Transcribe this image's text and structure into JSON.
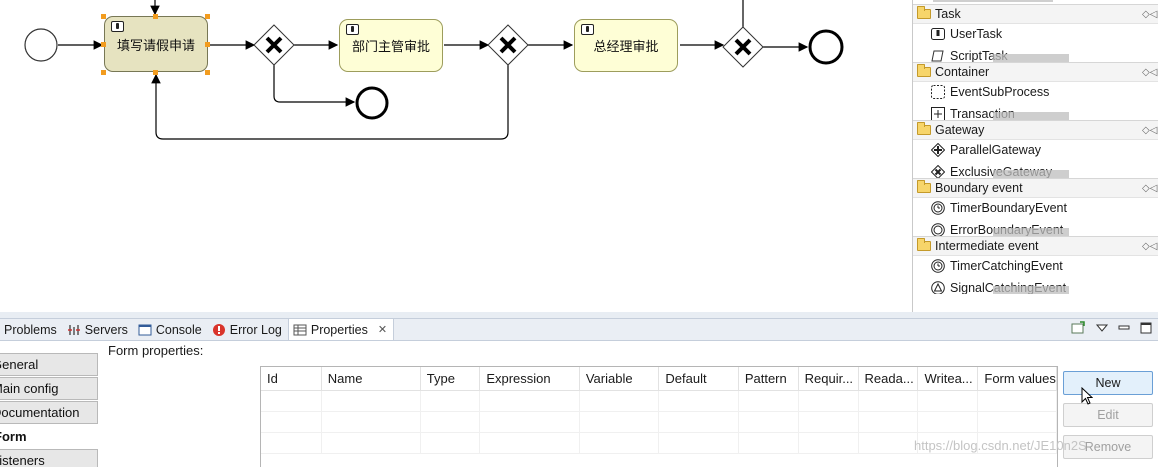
{
  "diagram": {
    "tasks": [
      {
        "id": "task-fill",
        "label": "填写请假申请",
        "selected": true
      },
      {
        "id": "task-dept",
        "label": "部门主管审批",
        "selected": false
      },
      {
        "id": "task-gm",
        "label": "总经理审批",
        "selected": false
      }
    ]
  },
  "palette": {
    "drawers": [
      {
        "title": "Task",
        "item": "UserTask",
        "item_icon": "user-task-icon",
        "cut_item": "ScriptTask"
      },
      {
        "title": "Container",
        "item": "EventSubProcess",
        "item_icon": "event-subprocess-icon",
        "cut_item": "Transaction"
      },
      {
        "title": "Gateway",
        "item": "ParallelGateway",
        "item_icon": "parallel-gateway-icon",
        "cut_item": "ExclusiveGateway"
      },
      {
        "title": "Boundary event",
        "item": "TimerBoundaryEvent",
        "item_icon": "timer-icon",
        "cut_item": "ErrorBoundaryEvent"
      },
      {
        "title": "Intermediate event",
        "item": "TimerCatchingEvent",
        "item_icon": "timer-icon",
        "cut_item": "SignalCatchingEvent"
      }
    ]
  },
  "views": {
    "tabs": [
      {
        "label": "Problems",
        "icon": "problems-icon",
        "active": false
      },
      {
        "label": "Servers",
        "icon": "servers-icon",
        "active": false
      },
      {
        "label": "Console",
        "icon": "console-icon",
        "active": false
      },
      {
        "label": "Error Log",
        "icon": "error-log-icon",
        "active": false
      },
      {
        "label": "Properties",
        "icon": "properties-icon",
        "active": true
      }
    ],
    "close_glyph": "✕"
  },
  "properties": {
    "side_tabs": [
      {
        "label": "General",
        "active": false
      },
      {
        "label": "Main config",
        "active": false
      },
      {
        "label": "Documentation",
        "active": false
      },
      {
        "label": "Form",
        "active": true
      },
      {
        "label": "Listeners",
        "active": false
      }
    ],
    "form_label": "Form properties:",
    "columns": [
      "Id",
      "Name",
      "Type",
      "Expression",
      "Variable",
      "Default",
      "Pattern",
      "Requir...",
      "Reada...",
      "Writea...",
      "Form values"
    ],
    "buttons": {
      "new": "New",
      "edit": "Edit",
      "remove": "Remove"
    }
  },
  "watermark": "https://blog.csdn.net/JE10n2S"
}
